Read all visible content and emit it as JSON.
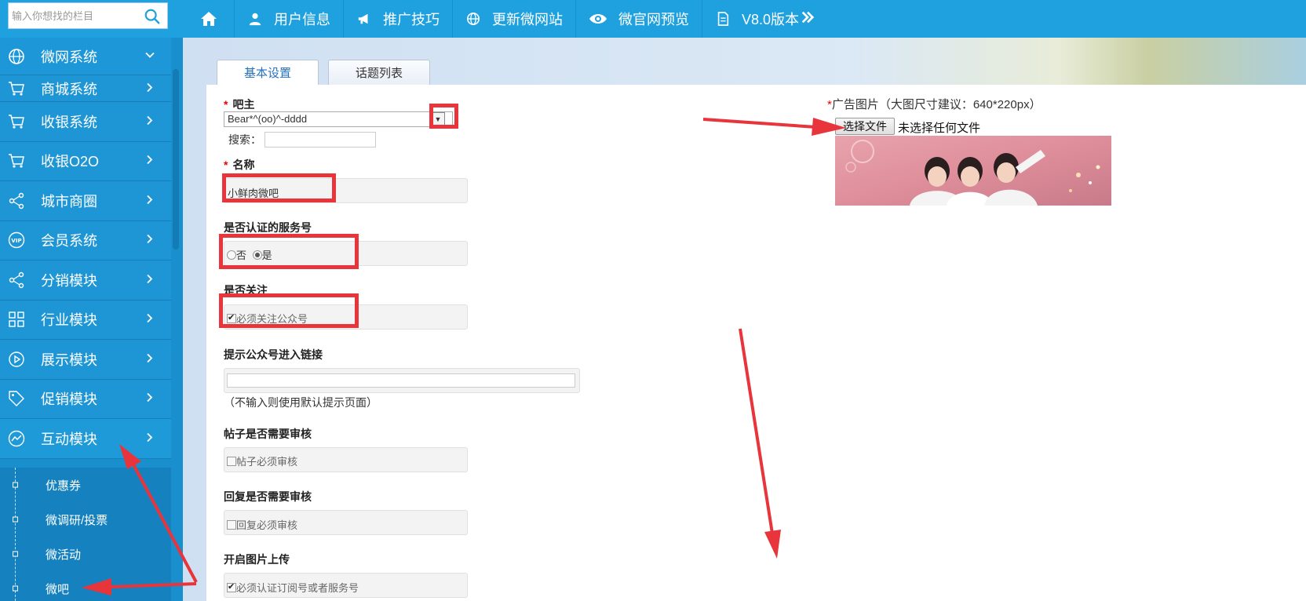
{
  "search": {
    "placeholder": "输入你想找的栏目"
  },
  "topnav": [
    {
      "label": "用户信息",
      "icon": "user-icon"
    },
    {
      "label": "推广技巧",
      "icon": "megaphone-icon"
    },
    {
      "label": "更新微网站",
      "icon": "globe-icon"
    },
    {
      "label": "微官网预览",
      "icon": "eye-icon"
    },
    {
      "label": "V8.0版本",
      "icon": "document-icon"
    }
  ],
  "sidebar": {
    "items": [
      {
        "label": "微网系统",
        "icon": "globe-icon",
        "expanded": true
      },
      {
        "label": "商城系统",
        "icon": "cart-icon"
      },
      {
        "label": "收银系统",
        "icon": "cart-icon"
      },
      {
        "label": "收银O2O",
        "icon": "cart-icon"
      },
      {
        "label": "城市商圈",
        "icon": "share-icon"
      },
      {
        "label": "会员系统",
        "icon": "vip-icon"
      },
      {
        "label": "分销模块",
        "icon": "share-icon"
      },
      {
        "label": "行业模块",
        "icon": "grid-icon"
      },
      {
        "label": "展示模块",
        "icon": "play-icon"
      },
      {
        "label": "促销模块",
        "icon": "tag-icon"
      },
      {
        "label": "互动模块",
        "icon": "chart-icon"
      }
    ],
    "subitems": [
      {
        "label": "优惠券"
      },
      {
        "label": "微调研/投票"
      },
      {
        "label": "微活动"
      },
      {
        "label": "微吧"
      }
    ]
  },
  "tabs": [
    {
      "label": "基本设置",
      "active": true
    },
    {
      "label": "话题列表",
      "active": false
    }
  ],
  "form": {
    "owner_label": "吧主",
    "owner_value": "Bear*^(oo)^-dddd",
    "owner_search_label": "搜索：",
    "name_label": "名称",
    "name_value": "小鲜肉微吧",
    "certified_label": "是否认证的服务号",
    "certified_no": "否",
    "certified_yes": "是",
    "follow_label": "是否关注",
    "follow_option": "必须关注公众号",
    "link_label": "提示公众号进入链接",
    "link_hint": "（不输入则使用默认提示页面）",
    "post_review_label": "帖子是否需要审核",
    "post_review_option": "帖子必须审核",
    "reply_review_label": "回复是否需要审核",
    "reply_review_option": "回复必须审核",
    "image_upload_label": "开启图片上传",
    "image_upload_option": "必须认证订阅号或者服务号",
    "required_mark": "*"
  },
  "ad": {
    "label": "广告图片（大图尺寸建议：640*220px）",
    "file_button": "选择文件",
    "file_status": "未选择任何文件"
  },
  "colors": {
    "topbar": "#1ea1de",
    "sidebar": "#1e96d6",
    "highlight": "#e8343b",
    "tab_active_text": "#2472c0"
  }
}
